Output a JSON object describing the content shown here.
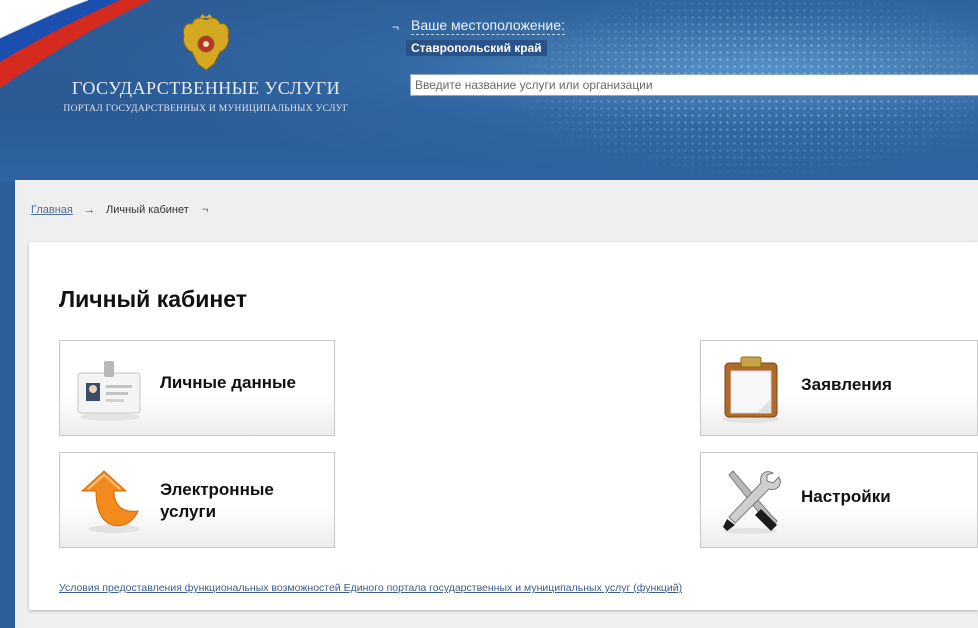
{
  "header": {
    "title": "ГОСУДАРСТВЕННЫЕ УСЛУГИ",
    "subtitle": "ПОРТАЛ ГОСУДАРСТВЕННЫХ И МУНИЦИПАЛЬНЫХ УСЛУГ",
    "location_label": "Ваше местоположение:",
    "location_value": "Ставропольский край",
    "search_placeholder": "Введите название услуги или организации"
  },
  "breadcrumb": {
    "home": "Главная",
    "arrow": "→",
    "current": "Личный кабинет",
    "tail_icon": "¬"
  },
  "cabinet": {
    "title": "Личный кабинет",
    "cards": [
      {
        "label": "Личные данные",
        "icon": "id-card-icon"
      },
      {
        "label": "Электронные услуги",
        "label_line1": "Электронные",
        "label_line2": "услуги",
        "icon": "orange-arrow-icon"
      },
      {
        "label": "Заявления",
        "icon": "clipboard-icon"
      },
      {
        "label": "Настройки",
        "icon": "tools-icon"
      }
    ],
    "terms_link": "Условия предоставления функциональных возможностей Единого портала государственных и муниципальных услуг (функций)"
  },
  "colors": {
    "header_blue": "#2d5c96",
    "link": "#3c5d8c",
    "flag_red": "#d52b1e",
    "flag_blue": "#0039a6"
  }
}
